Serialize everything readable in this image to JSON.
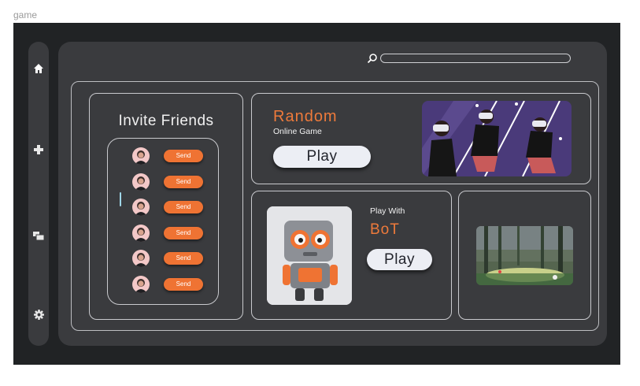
{
  "frame_label": "game",
  "sidebar": {
    "items": [
      {
        "icon": "home-icon"
      },
      {
        "icon": "plus-icon"
      },
      {
        "icon": "chat-icon"
      },
      {
        "icon": "gear-icon"
      }
    ]
  },
  "search": {
    "placeholder": "",
    "value": ""
  },
  "invite": {
    "title": "Invite Friends",
    "friends": [
      {
        "send_label": "Send"
      },
      {
        "send_label": "Send"
      },
      {
        "send_label": "Send"
      },
      {
        "send_label": "Send"
      },
      {
        "send_label": "Send"
      },
      {
        "send_label": "Send"
      }
    ]
  },
  "random_game": {
    "title": "Random",
    "subtitle": "Online Game",
    "play_label": "Play"
  },
  "bot_game": {
    "pretitle": "Play With",
    "title": "BoT",
    "play_label": "Play"
  },
  "colors": {
    "accent": "#ef7333",
    "background": "#212325",
    "panel": "#3a3b3e",
    "button_light": "#eceef4"
  }
}
